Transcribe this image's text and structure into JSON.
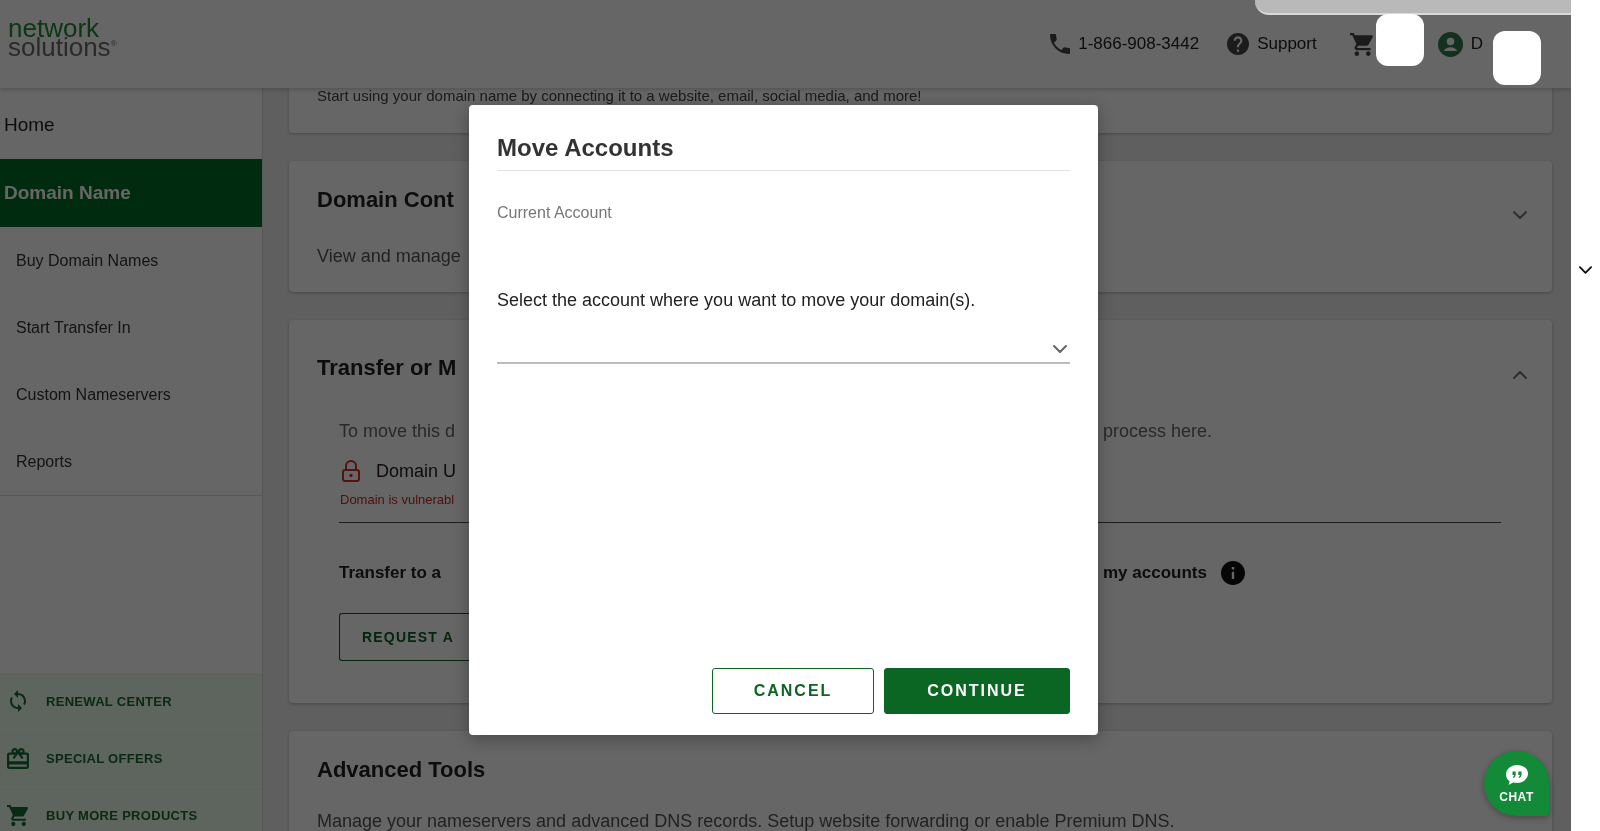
{
  "header": {
    "logo": {
      "line1": "network",
      "line2": "solutions$^{®}$"
    },
    "phone": "1-866-908-3442",
    "support": "Support",
    "account_name": "D"
  },
  "sidebar": {
    "items": [
      {
        "label": "Home",
        "selected": false
      },
      {
        "label": "Domain Name",
        "selected": true,
        "children": [
          {
            "label": "Buy Domain Names",
            "selected": false
          },
          {
            "label": "Start Transfer In",
            "selected": false
          },
          {
            "label": "Custom Nameservers",
            "selected": false
          },
          {
            "label": "Reports",
            "selected": false
          }
        ]
      }
    ],
    "links": [
      {
        "label": "RENEWAL CENTER"
      },
      {
        "label": "SPECIAL OFFERS"
      },
      {
        "label": "BUY MORE PRODUCTS"
      }
    ]
  },
  "cards": [
    {
      "text": "Start using your domain name by connecting it to a website, email, social media, and more!"
    },
    {
      "title": "Domain Cont",
      "subtitle": "View and manage",
      "expanded": false
    },
    {
      "title": "Transfer or M",
      "expanded": true,
      "body": {
        "intro": {
          "left": "To move this d",
          "right": "process here."
        },
        "lock": {
          "label": "Domain U",
          "warning": "Domain is vulnerabl"
        },
        "option": {
          "left": "Transfer to a",
          "right": "my accounts"
        },
        "button": "REQUEST A"
      }
    },
    {
      "title": "Advanced Tools",
      "subtitle": "Manage your nameservers and advanced DNS records. Setup website forwarding or enable Premium DNS."
    }
  ],
  "modal": {
    "title": "Move Accounts",
    "field_label": "Current Account",
    "prompt": "Select the account where you want to move your domain(s).",
    "buttons": [
      {
        "label": "CANCEL",
        "kind": "secondary"
      },
      {
        "label": "CONTINUE",
        "kind": "primary"
      }
    ]
  },
  "chat": {
    "label": "CHAT"
  }
}
